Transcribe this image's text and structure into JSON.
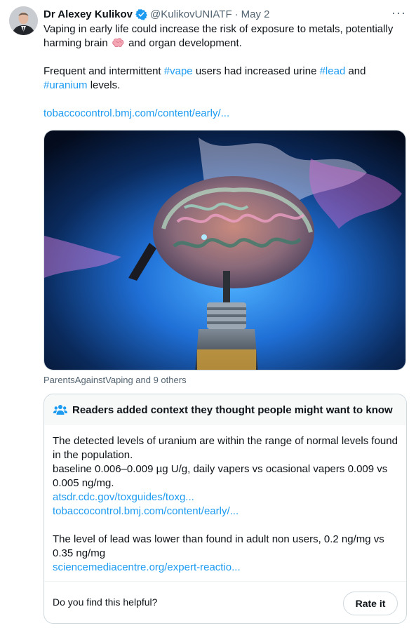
{
  "tweet": {
    "author_name": "Dr Alexey Kulikov",
    "handle": "@KulikovUNIATF",
    "separator": "·",
    "date": "May 2",
    "more_label": "···",
    "verified_color": "#1d9bf0",
    "text_line1_prefix": "Vaping in early life could increase the risk of exposure to metals, potentially harming brain",
    "text_line1_emoji": "brain-emoji",
    "text_line1_suffix": "and organ development.",
    "text_line2_a": "Frequent and intermittent",
    "hashtag_vape": "#vape",
    "text_line2_b": "users had increased urine",
    "hashtag_lead": "#lead",
    "text_line2_c": "and",
    "hashtag_uranium": "#uranium",
    "text_line2_d": "levels.",
    "link": "tobaccocontrol.bmj.com/content/early/...",
    "likers": "ParentsAgainstVaping and 9 others"
  },
  "community_note": {
    "header": "Readers added context they thought people might want to know",
    "icon": "people-icon",
    "para1": "The detected levels of uranium are within the range of normal levels found in the population.",
    "para2": "baseline 0.006–0.009 µg U/g, daily vapers vs ocasional vapers 0.009 vs 0.005  ng/mg.",
    "link1": "atsdr.cdc.gov/toxguides/toxg...",
    "link2": "tobaccocontrol.bmj.com/content/early/...",
    "para3": "The level of lead was lower than found in adult non users, 0.2 ng/mg vs 0.35 ng/mg",
    "link3": "sciencemediacentre.org/expert-reactio...",
    "helpful_question": "Do you find this helpful?",
    "rate_button": "Rate it"
  },
  "colors": {
    "link": "#1d9bf0",
    "secondary_text": "#536471",
    "note_header_bg": "#f7f9f9",
    "border": "#cfd9de"
  }
}
